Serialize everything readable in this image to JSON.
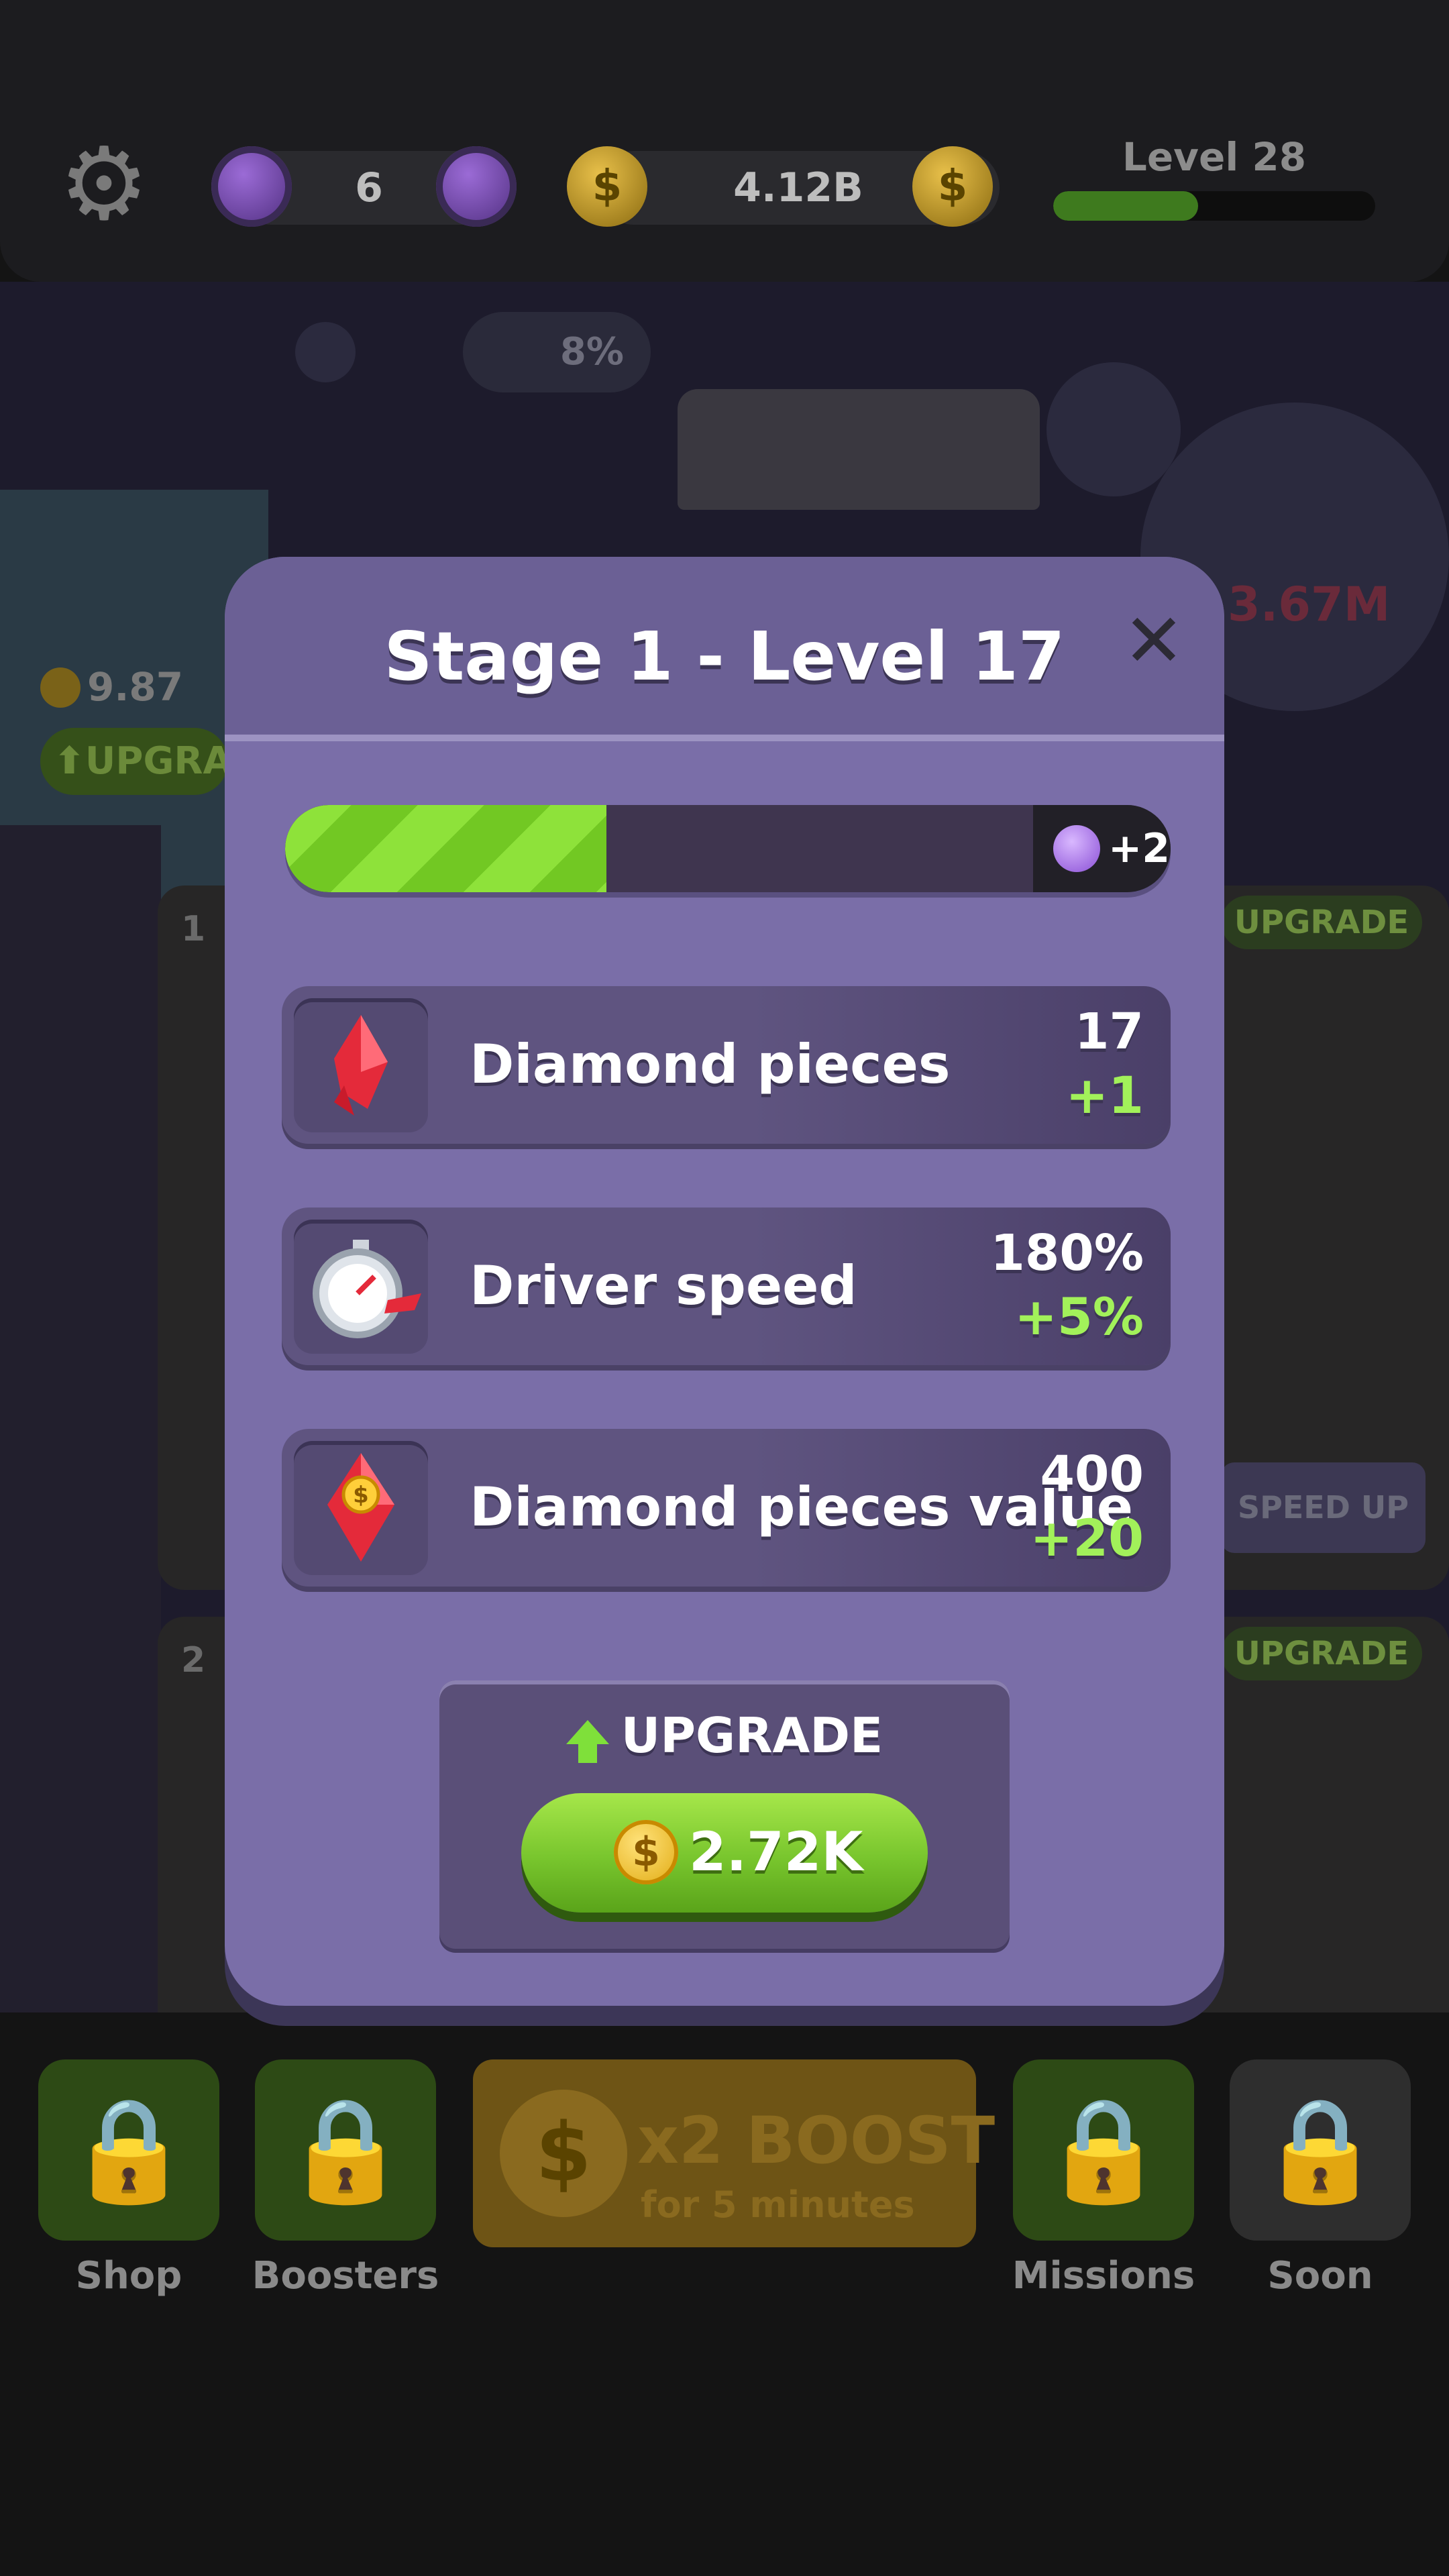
{
  "topbar": {
    "gems": "6",
    "coins": "4.12B",
    "level_title": "Level 28",
    "level_progress": 0.45
  },
  "background": {
    "boost_percent": "8%",
    "left_machine_value": "9.87",
    "left_machine_upgrade": "UPGRA",
    "gem_bg_value": "3.67M",
    "lane1_number": "1",
    "lane2_number": "2",
    "lane1_upgrade": "UPGRADE",
    "lane2_upgrade": "UPGRADE",
    "speed_up": "SPEED UP",
    "boost_title": "x2 BOOST",
    "boost_subtitle": "for 5 minutes"
  },
  "nav": {
    "items": [
      {
        "label": "Shop"
      },
      {
        "label": "Boosters"
      },
      {
        "label": "Missions"
      },
      {
        "label": "Soon"
      }
    ]
  },
  "modal": {
    "title": "Stage 1 - Level 17",
    "progress_fraction": 0.43,
    "reward": "+2",
    "stats": [
      {
        "name": "Diamond pieces",
        "value": "17",
        "increment": "+1",
        "icon": "red-crystal-icon"
      },
      {
        "name": "Driver speed",
        "value": "180%",
        "increment": "+5%",
        "icon": "stopwatch-icon"
      },
      {
        "name": "Diamond pieces value",
        "value": "400",
        "increment": "+20",
        "icon": "red-gem-coin-icon"
      }
    ],
    "upgrade_label": "UPGRADE",
    "upgrade_cost": "2.72K"
  },
  "colors": {
    "modal_bg": "#7a6ea8",
    "progress_green": "#8ee23a",
    "increment_green": "#a2f15a",
    "button_green": "#78c52d"
  }
}
